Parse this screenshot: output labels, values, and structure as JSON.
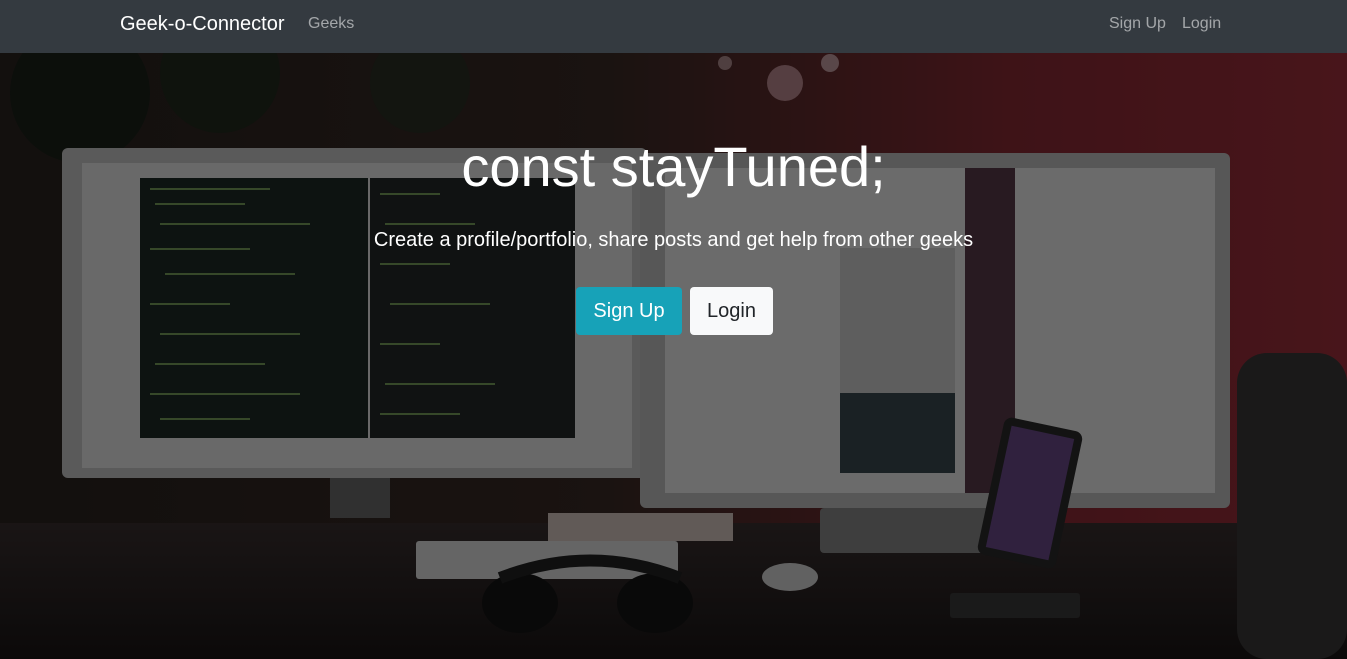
{
  "navbar": {
    "brand": "Geek-o-Connector",
    "links": {
      "geeks": "Geeks",
      "signup": "Sign Up",
      "login": "Login"
    }
  },
  "hero": {
    "title": "const stayTuned;",
    "lead": "Create a profile/portfolio, share posts and get help from other geeks",
    "buttons": {
      "signup": "Sign Up",
      "login": "Login"
    }
  },
  "colors": {
    "navbar_bg": "#343a40",
    "primary_button": "#17a2b8",
    "light_button": "#f8f9fa"
  }
}
